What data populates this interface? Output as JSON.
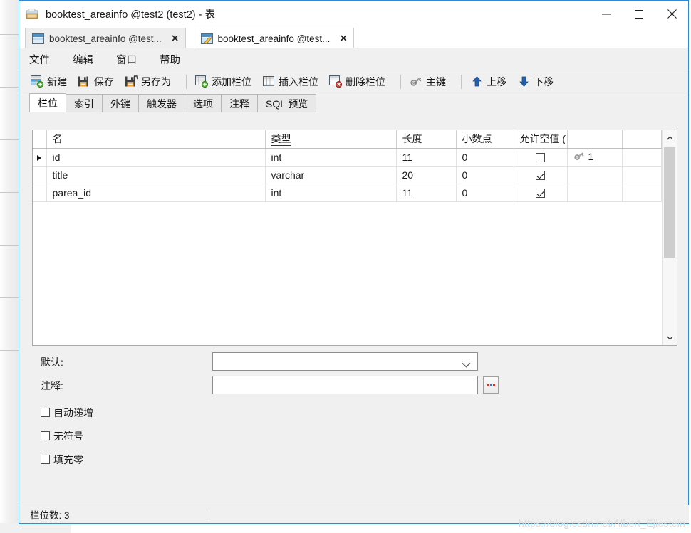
{
  "window": {
    "title": "booktest_areainfo @test2 (test2) - 表",
    "title_icon": "table-design-icon",
    "controls": {
      "minimize": "minimize-icon",
      "maximize": "maximize-icon",
      "close": "close-icon"
    }
  },
  "doc_tabs": [
    {
      "label": "booktest_areainfo @test...",
      "icon": "table-data-icon",
      "close": "×",
      "active": false
    },
    {
      "label": "booktest_areainfo @test...",
      "icon": "table-design-icon",
      "close": "×",
      "active": true
    }
  ],
  "menu": [
    {
      "label": "文件"
    },
    {
      "label": "编辑"
    },
    {
      "label": "窗口"
    },
    {
      "label": "帮助"
    }
  ],
  "toolbar": [
    {
      "type": "button",
      "label": "新建",
      "icon": "new-table-icon"
    },
    {
      "type": "button",
      "label": "保存",
      "icon": "save-icon"
    },
    {
      "type": "button",
      "label": "另存为",
      "icon": "save-as-icon"
    },
    {
      "type": "separator"
    },
    {
      "type": "button",
      "label": "添加栏位",
      "icon": "add-field-icon"
    },
    {
      "type": "button",
      "label": "插入栏位",
      "icon": "insert-field-icon"
    },
    {
      "type": "button",
      "label": "删除栏位",
      "icon": "delete-field-icon"
    },
    {
      "type": "separator"
    },
    {
      "type": "button",
      "label": "主键",
      "icon": "primary-key-icon"
    },
    {
      "type": "separator"
    },
    {
      "type": "button",
      "label": "上移",
      "icon": "arrow-up-icon"
    },
    {
      "type": "button",
      "label": "下移",
      "icon": "arrow-down-icon"
    }
  ],
  "property_tabs": [
    {
      "label": "栏位",
      "active": true
    },
    {
      "label": "索引",
      "active": false
    },
    {
      "label": "外键",
      "active": false
    },
    {
      "label": "触发器",
      "active": false
    },
    {
      "label": "选项",
      "active": false
    },
    {
      "label": "注释",
      "active": false
    },
    {
      "label": "SQL 预览",
      "active": false
    }
  ],
  "grid": {
    "columns": [
      {
        "label": "名",
        "sorted": false
      },
      {
        "label": "类型",
        "sorted": true
      },
      {
        "label": "长度",
        "sorted": false
      },
      {
        "label": "小数点",
        "sorted": false
      },
      {
        "label": "允许空值 (",
        "sorted": false
      },
      {
        "label": "",
        "sorted": false
      },
      {
        "label": "",
        "sorted": false
      }
    ],
    "rows": [
      {
        "selected": true,
        "name": "id",
        "type": "int",
        "length": "11",
        "decimals": "0",
        "nullable": false,
        "key_icon": "primary-key-icon",
        "key_order": "1"
      },
      {
        "selected": false,
        "name": "title",
        "type": "varchar",
        "length": "20",
        "decimals": "0",
        "nullable": true,
        "key_icon": "",
        "key_order": ""
      },
      {
        "selected": false,
        "name": "parea_id",
        "type": "int",
        "length": "11",
        "decimals": "0",
        "nullable": true,
        "key_icon": "",
        "key_order": ""
      }
    ],
    "scrollbar": {
      "up": "chevron-up-icon",
      "down": "chevron-down-icon"
    }
  },
  "form": {
    "default_label": "默认:",
    "default_value": "",
    "default_chevron": "chevron-down-icon",
    "comment_label": "注释:",
    "comment_value": "",
    "ellipsis_button": "...",
    "checkboxes": [
      {
        "label": "自动递增",
        "checked": false
      },
      {
        "label": "无符号",
        "checked": false
      },
      {
        "label": "填充零",
        "checked": false
      }
    ]
  },
  "status": {
    "text": "栏位数: 3"
  },
  "watermark": "https://blog.csdn.net/Albert_Ejiestein",
  "colors": {
    "window_border": "#2f8ad4",
    "chrome_bg": "#f0f0f0",
    "grid_bg": "#ffffff",
    "text": "#1a1a1a"
  }
}
